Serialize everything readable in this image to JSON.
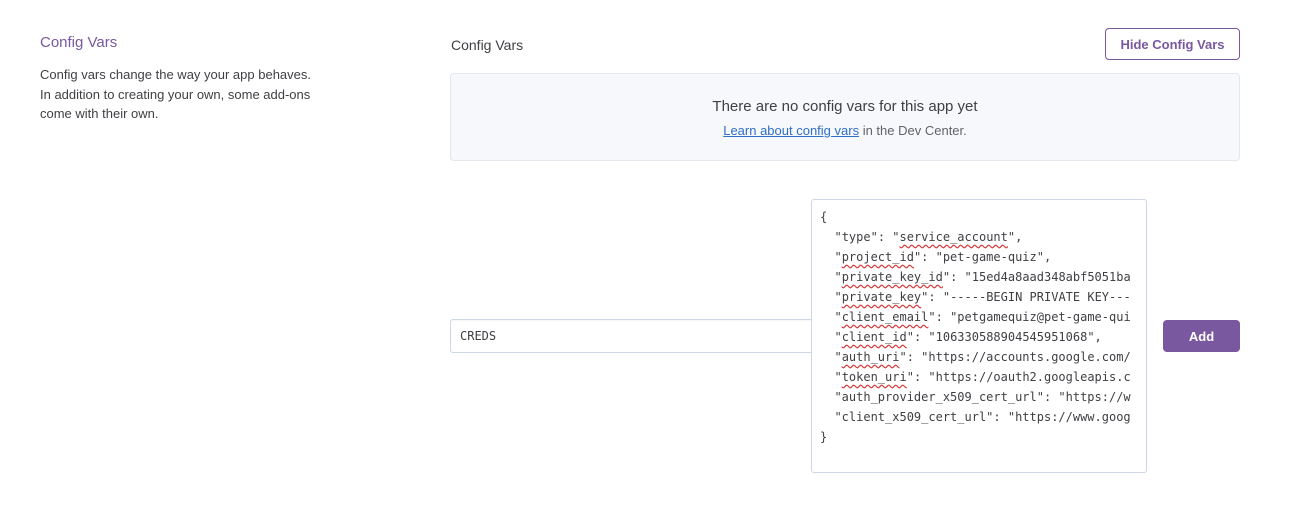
{
  "sidebar": {
    "title": "Config Vars",
    "description": "Config vars change the way your app behaves. In addition to creating your own, some add-ons come with their own."
  },
  "main": {
    "title": "Config Vars",
    "hide_button_label": "Hide Config Vars",
    "empty_state": {
      "title": "There are no config vars for this app yet",
      "link_text": "Learn about config vars",
      "suffix": " in the Dev Center."
    }
  },
  "new_var": {
    "key_value": "CREDS",
    "value_lines": [
      [
        {
          "t": "{"
        }
      ],
      [
        {
          "t": "  \""
        },
        {
          "t": "type",
          "sq": false
        },
        {
          "t": "\": \""
        },
        {
          "t": "service_account",
          "sq": true
        },
        {
          "t": "\","
        }
      ],
      [
        {
          "t": "  \""
        },
        {
          "t": "project_id",
          "sq": true
        },
        {
          "t": "\": \"pet-game-quiz\","
        }
      ],
      [
        {
          "t": "  \""
        },
        {
          "t": "private_key_id",
          "sq": true
        },
        {
          "t": "\": \"15ed4a8aad348abf5051ba"
        }
      ],
      [
        {
          "t": "  \""
        },
        {
          "t": "private_key",
          "sq": true
        },
        {
          "t": "\": \"-----BEGIN PRIVATE KEY---"
        }
      ],
      [
        {
          "t": "  \""
        },
        {
          "t": "client_email",
          "sq": true
        },
        {
          "t": "\": \"petgamequiz@pet-game-qui"
        }
      ],
      [
        {
          "t": "  \""
        },
        {
          "t": "client_id",
          "sq": true
        },
        {
          "t": "\": \"106330588904545951068\","
        }
      ],
      [
        {
          "t": "  \""
        },
        {
          "t": "auth_uri",
          "sq": true
        },
        {
          "t": "\": \"https://accounts.google.com/"
        }
      ],
      [
        {
          "t": "  \""
        },
        {
          "t": "token_uri",
          "sq": true
        },
        {
          "t": "\": \"https://oauth2.googleapis.c"
        }
      ],
      [
        {
          "t": "  \"auth_provider_x509_cert_url\": \"https://w"
        }
      ],
      [
        {
          "t": "  \"client_x509_cert_url\": \"https://www.goog"
        }
      ],
      [
        {
          "t": "}"
        }
      ]
    ],
    "add_button_label": "Add"
  },
  "colors": {
    "accent": "#79589f",
    "link": "#2f6fc6",
    "spellcheck": "#d93a3a"
  }
}
